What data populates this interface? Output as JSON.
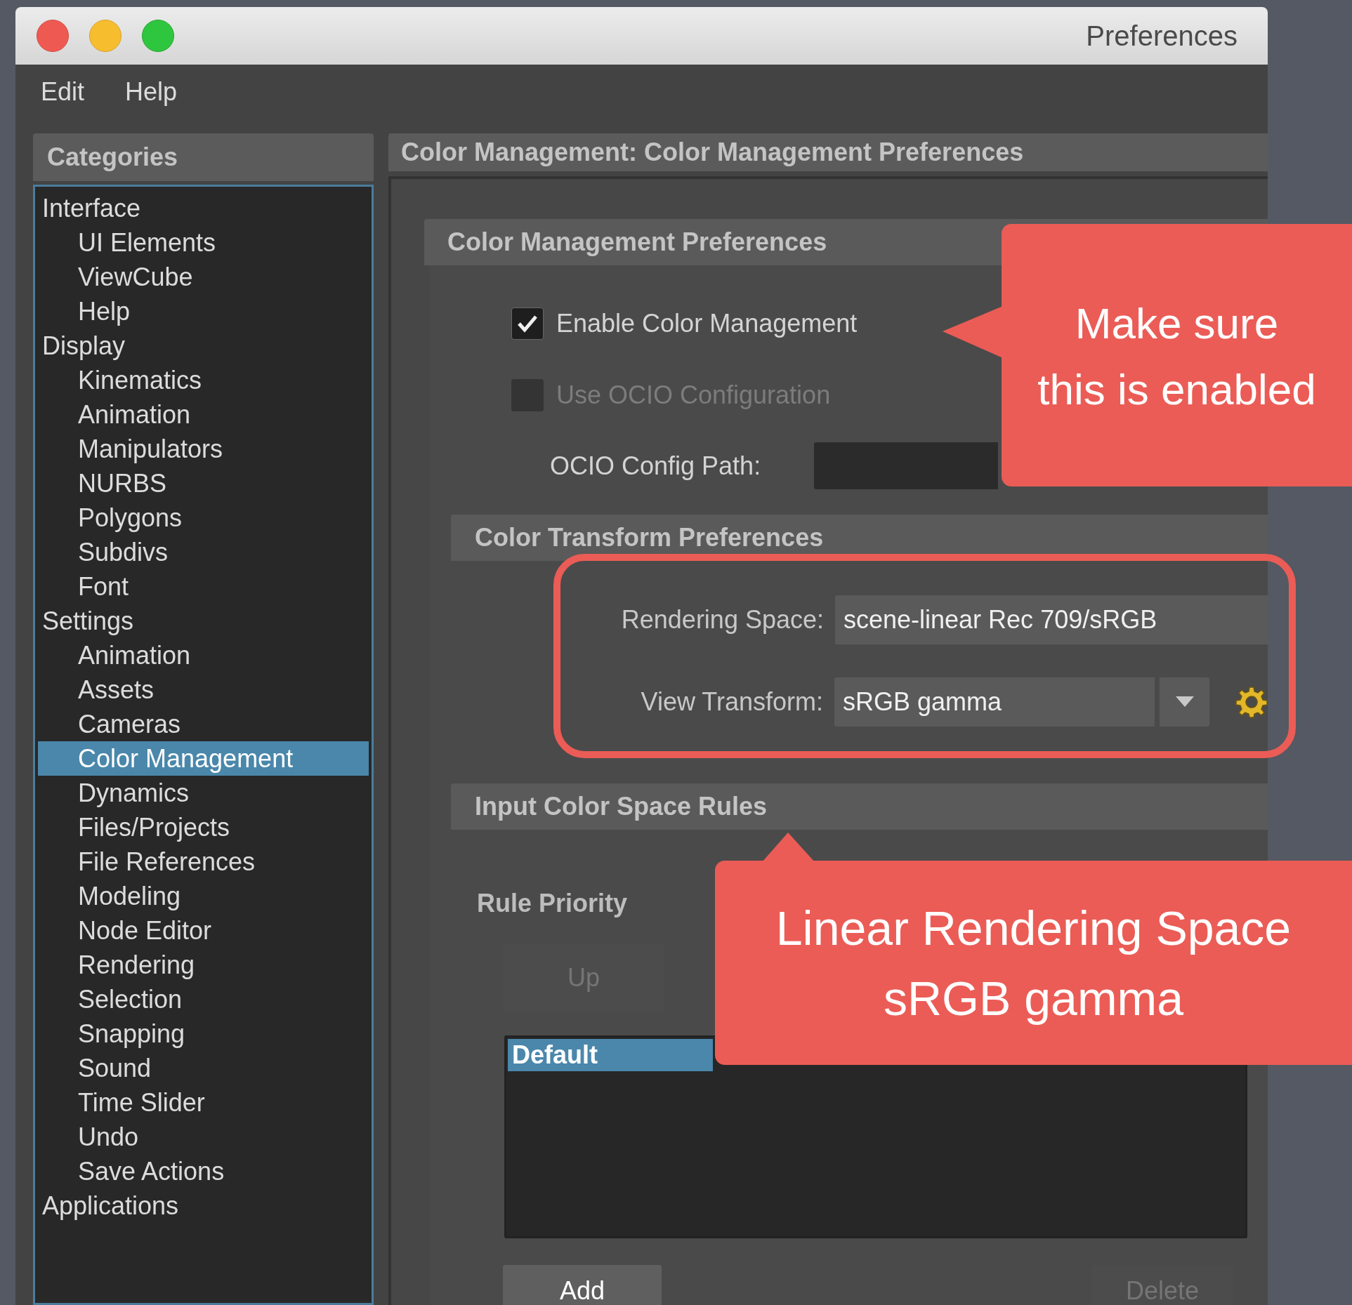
{
  "window": {
    "title": "Preferences"
  },
  "menu": [
    "Edit",
    "Help"
  ],
  "categories": {
    "title": "Categories",
    "items": [
      {
        "label": "Interface",
        "selected": false,
        "children": [
          {
            "label": "UI Elements",
            "selected": false
          },
          {
            "label": "ViewCube",
            "selected": false
          },
          {
            "label": "Help",
            "selected": false
          }
        ]
      },
      {
        "label": "Display",
        "selected": false,
        "children": [
          {
            "label": "Kinematics",
            "selected": false
          },
          {
            "label": "Animation",
            "selected": false
          },
          {
            "label": "Manipulators",
            "selected": false
          },
          {
            "label": "NURBS",
            "selected": false
          },
          {
            "label": "Polygons",
            "selected": false
          },
          {
            "label": "Subdivs",
            "selected": false
          },
          {
            "label": "Font",
            "selected": false
          }
        ]
      },
      {
        "label": "Settings",
        "selected": false,
        "children": [
          {
            "label": "Animation",
            "selected": false
          },
          {
            "label": "Assets",
            "selected": false
          },
          {
            "label": "Cameras",
            "selected": false
          },
          {
            "label": "Color Management",
            "selected": true
          },
          {
            "label": "Dynamics",
            "selected": false
          },
          {
            "label": "Files/Projects",
            "selected": false
          },
          {
            "label": "File References",
            "selected": false
          },
          {
            "label": "Modeling",
            "selected": false
          },
          {
            "label": "Node Editor",
            "selected": false
          },
          {
            "label": "Rendering",
            "selected": false
          },
          {
            "label": "Selection",
            "selected": false
          },
          {
            "label": "Snapping",
            "selected": false
          },
          {
            "label": "Sound",
            "selected": false
          },
          {
            "label": "Time Slider",
            "selected": false
          },
          {
            "label": "Undo",
            "selected": false
          },
          {
            "label": "Save Actions",
            "selected": false
          }
        ]
      },
      {
        "label": "Applications",
        "selected": false
      }
    ]
  },
  "panel": {
    "title": "Color Management: Color Management Preferences",
    "color_management": {
      "title": "Color Management Preferences",
      "options": [
        {
          "label": "Enable Color Management",
          "checked": true,
          "disabled": false
        },
        {
          "label": "Use OCIO Configuration",
          "checked": false,
          "disabled": true
        }
      ],
      "config_path": {
        "label": "OCIO Config Path:"
      }
    },
    "color_transform": {
      "title": "Color Transform Preferences",
      "rendering_space": {
        "label": "Rendering Space:",
        "value": "scene-linear Rec 709/sRGB"
      },
      "view_transform": {
        "label": "View Transform:",
        "value": "sRGB gamma"
      }
    },
    "input_rules": {
      "title": "Input Color Space Rules",
      "priority_label": "Rule Priority",
      "up_button": {
        "label": "Up",
        "disabled": true
      },
      "rules": [
        {
          "label": "Default",
          "selected": true
        }
      ],
      "add_button": {
        "label": "Add",
        "disabled": false
      },
      "delete_button": {
        "label": "Delete",
        "disabled": true
      }
    }
  },
  "annotations": [
    {
      "lines": [
        "Make sure",
        "this is enabled"
      ]
    },
    {
      "lines": [
        "Linear Rendering Space",
        "sRGB gamma"
      ]
    }
  ]
}
